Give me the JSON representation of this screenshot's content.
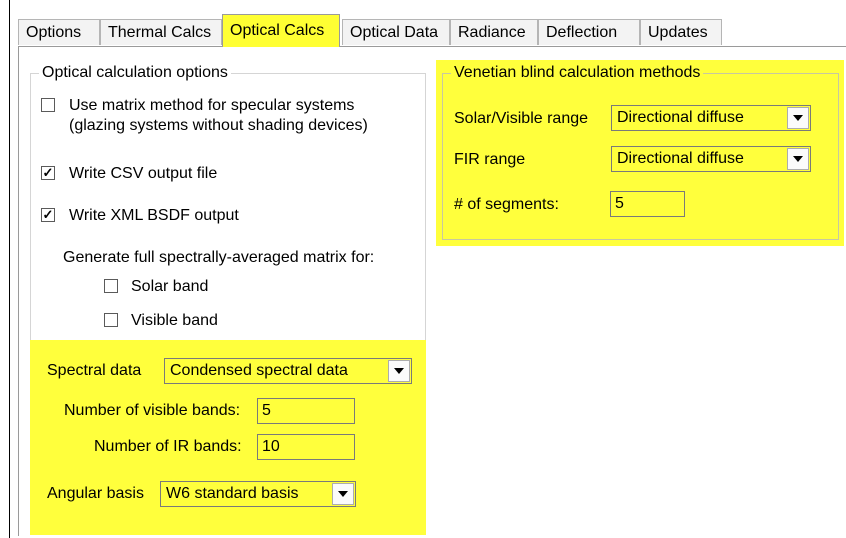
{
  "tabs": [
    {
      "label": "Options",
      "active": false
    },
    {
      "label": "Thermal Calcs",
      "active": false
    },
    {
      "label": "Optical Calcs",
      "active": true
    },
    {
      "label": "Optical Data",
      "active": false
    },
    {
      "label": "Radiance",
      "active": false
    },
    {
      "label": "Deflection",
      "active": false
    },
    {
      "label": "Updates",
      "active": false
    }
  ],
  "optical_group": {
    "title": "Optical calculation options",
    "matrix_method": {
      "line1": "Use matrix method for specular systems",
      "line2": "(glazing systems without shading devices)",
      "checked": false
    },
    "write_csv": {
      "label": "Write CSV output file",
      "checked": true
    },
    "write_xml": {
      "label": "Write XML BSDF output",
      "checked": true
    },
    "generate_label": "Generate full spectrally-averaged matrix for:",
    "solar_band": {
      "label": "Solar band",
      "checked": false
    },
    "visible_band": {
      "label": "Visible band",
      "checked": false
    },
    "spectral_data": {
      "label": "Spectral data",
      "value": "Condensed spectral data"
    },
    "visible_bands": {
      "label": "Number of visible bands:",
      "value": "5"
    },
    "ir_bands": {
      "label": "Number of IR bands:",
      "value": "10"
    },
    "angular_basis": {
      "label": "Angular basis",
      "value": "W6 standard basis"
    }
  },
  "venetian_group": {
    "title": "Venetian blind calculation methods",
    "solar_visible": {
      "label": "Solar/Visible range",
      "value": "Directional diffuse"
    },
    "fir": {
      "label": "FIR range",
      "value": "Directional diffuse"
    },
    "segments": {
      "label": "# of segments:",
      "value": "5"
    }
  },
  "check_mark": "✓",
  "colors": {
    "highlight": "#ffff3c",
    "active_tab": "#ffff33"
  }
}
